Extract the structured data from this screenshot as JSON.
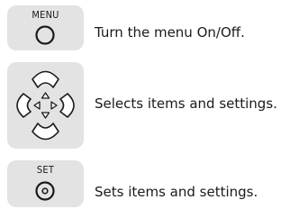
{
  "buttons": [
    {
      "label": "MENU",
      "description": "Turn the menu On/Off."
    },
    {
      "label": "",
      "description": "Selects items and settings."
    },
    {
      "label": "SET",
      "description": "Sets items and settings."
    }
  ]
}
